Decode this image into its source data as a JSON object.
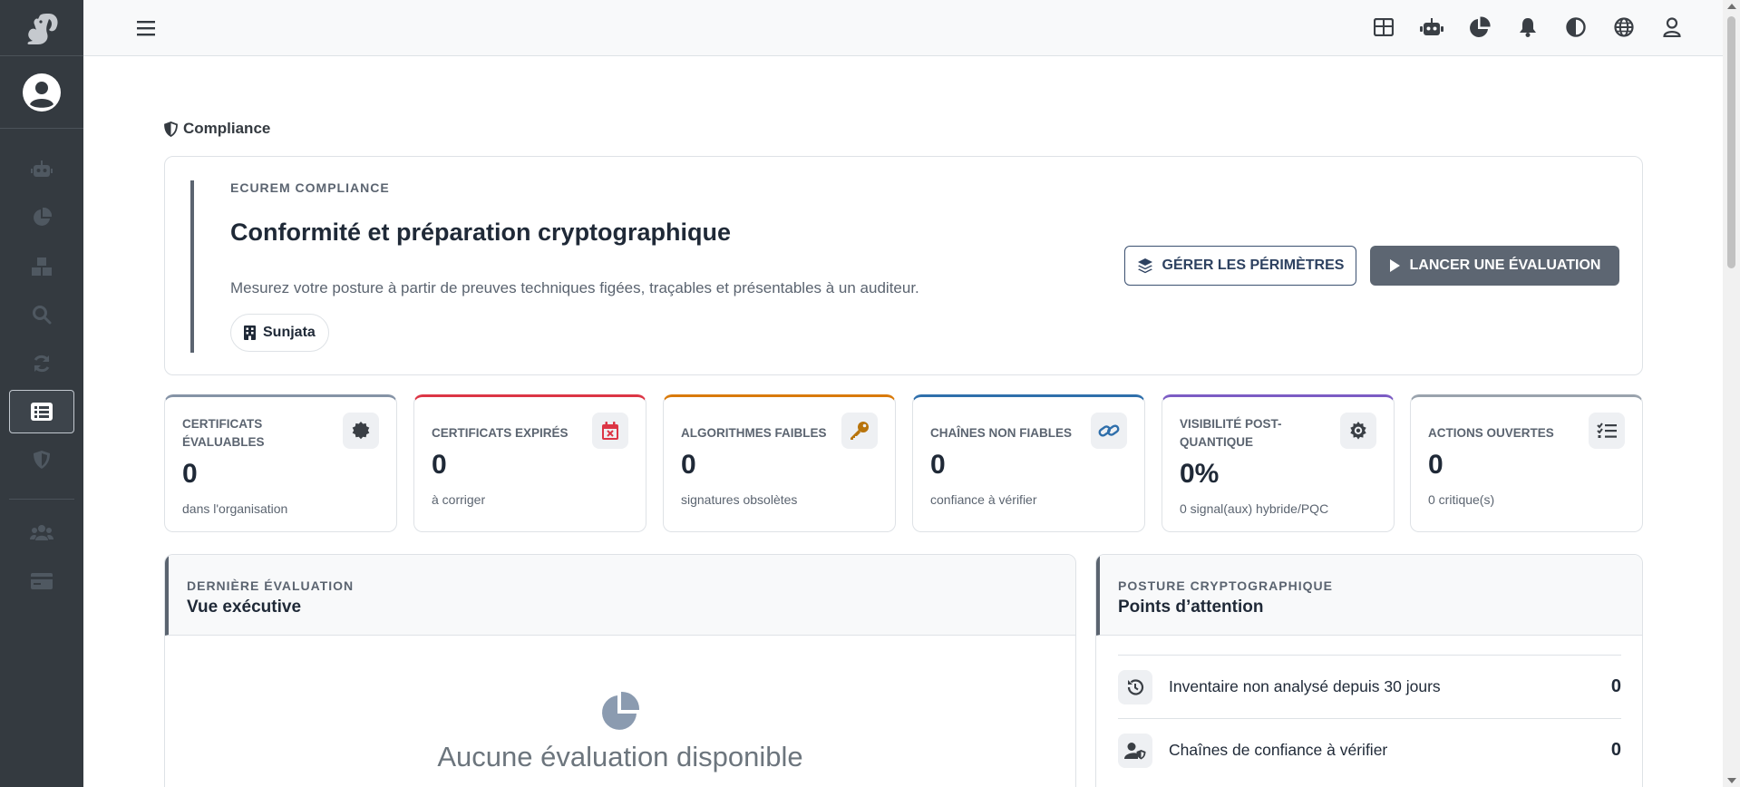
{
  "colors": {
    "sidebar_bg": "#343a40",
    "accent_dark": "#5d6672",
    "kpi_borders": [
      "#8593a6",
      "#dc3545",
      "#d97a0b",
      "#2f6fab",
      "#7c5cc4",
      "#9aa3ad"
    ],
    "kpi_icon_colors": [
      "#3a3f45",
      "#dc3545",
      "#b8740c",
      "#2f6fab",
      "#3a3f45",
      "#3a3f45"
    ]
  },
  "sidebar": {
    "icons": [
      "squirrel-logo-icon",
      "user-circle-icon",
      "robot-icon",
      "chart-pie-icon",
      "boxes-icon",
      "search-icon",
      "sync-icon",
      "list-icon",
      "shield-icon",
      "users-icon",
      "card-icon"
    ]
  },
  "topbar": {
    "icons": [
      "grid-icon",
      "robot-icon",
      "chart-pie-icon",
      "bell-icon",
      "contrast-icon",
      "globe-icon",
      "user-icon"
    ]
  },
  "breadcrumb": {
    "label": "Compliance"
  },
  "hero": {
    "kicker": "ECUREM COMPLIANCE",
    "title": "Conformité et préparation cryptographique",
    "subtitle": "Mesurez votre posture à partir de preuves techniques figées, traçables et présentables à un auditeur.",
    "organization": "Sunjata",
    "manage_label": "GÉRER LES PÉRIMÈTRES",
    "launch_label": "LANCER UNE ÉVALUATION"
  },
  "kpis": [
    {
      "label": "CERTIFICATS ÉVALUABLES",
      "value": "0",
      "note": "dans l'organisation"
    },
    {
      "label": "CERTIFICATS EXPIRÉS",
      "value": "0",
      "note": "à corriger"
    },
    {
      "label": "ALGORITHMES FAIBLES",
      "value": "0",
      "note": "signatures obsolètes"
    },
    {
      "label": "CHAÎNES NON FIABLES",
      "value": "0",
      "note": "confiance à vérifier"
    },
    {
      "label": "VISIBILITÉ POST-QUANTIQUE",
      "value": "0%",
      "note": "0 signal(aux) hybride/PQC"
    },
    {
      "label": "ACTIONS OUVERTES",
      "value": "0",
      "note": "0 critique(s)"
    }
  ],
  "exec": {
    "kicker": "DERNIÈRE ÉVALUATION",
    "title": "Vue exécutive",
    "empty": "Aucune évaluation disponible"
  },
  "posture": {
    "kicker": "POSTURE CRYPTOGRAPHIQUE",
    "title": "Points d’attention",
    "rows": [
      {
        "label": "Inventaire non analysé depuis 30 jours",
        "count": "0"
      },
      {
        "label": "Chaînes de confiance à vérifier",
        "count": "0"
      }
    ]
  }
}
